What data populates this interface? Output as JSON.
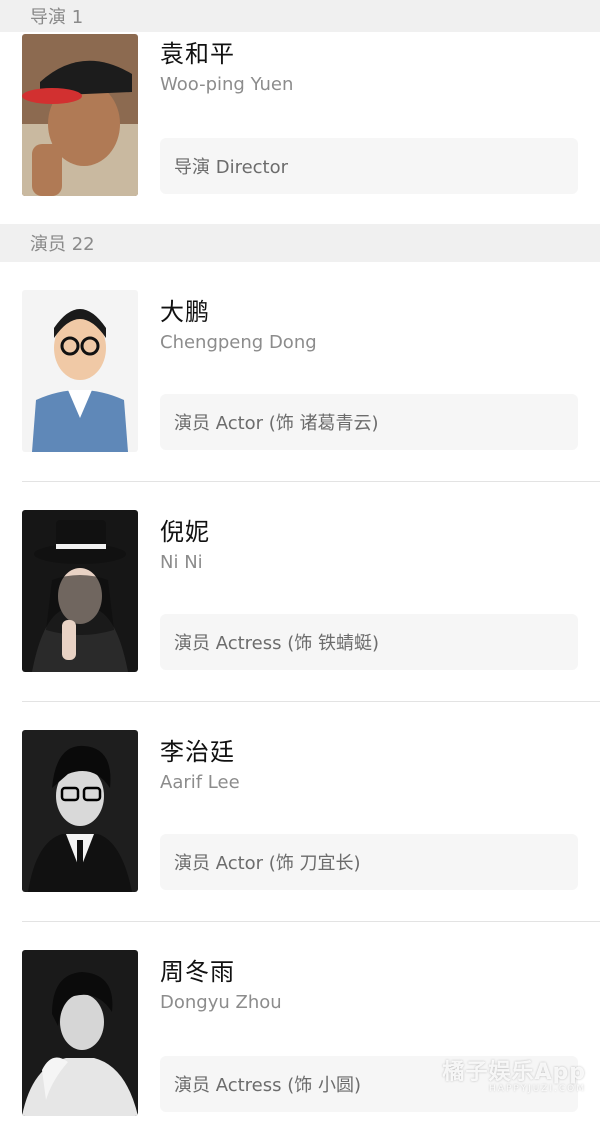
{
  "sections": {
    "director": {
      "label": "导演 1"
    },
    "cast": {
      "label": "演员 22"
    }
  },
  "people": [
    {
      "name_cn": "袁和平",
      "name_en": "Woo-ping Yuen",
      "role": "导演 Director"
    },
    {
      "name_cn": "大鹏",
      "name_en": "Chengpeng Dong",
      "role": "演员 Actor (饰 诸葛青云)"
    },
    {
      "name_cn": "倪妮",
      "name_en": "Ni Ni",
      "role": "演员 Actress (饰 铁蜻蜓)"
    },
    {
      "name_cn": "李治廷",
      "name_en": "Aarif Lee",
      "role": "演员 Actor (饰 刀宜长)"
    },
    {
      "name_cn": "周冬雨",
      "name_en": "Dongyu Zhou",
      "role": "演员 Actress (饰 小圆)"
    }
  ],
  "watermark": {
    "main": "橘子娱乐App",
    "sub": "HAPPYJUZI.COM"
  }
}
